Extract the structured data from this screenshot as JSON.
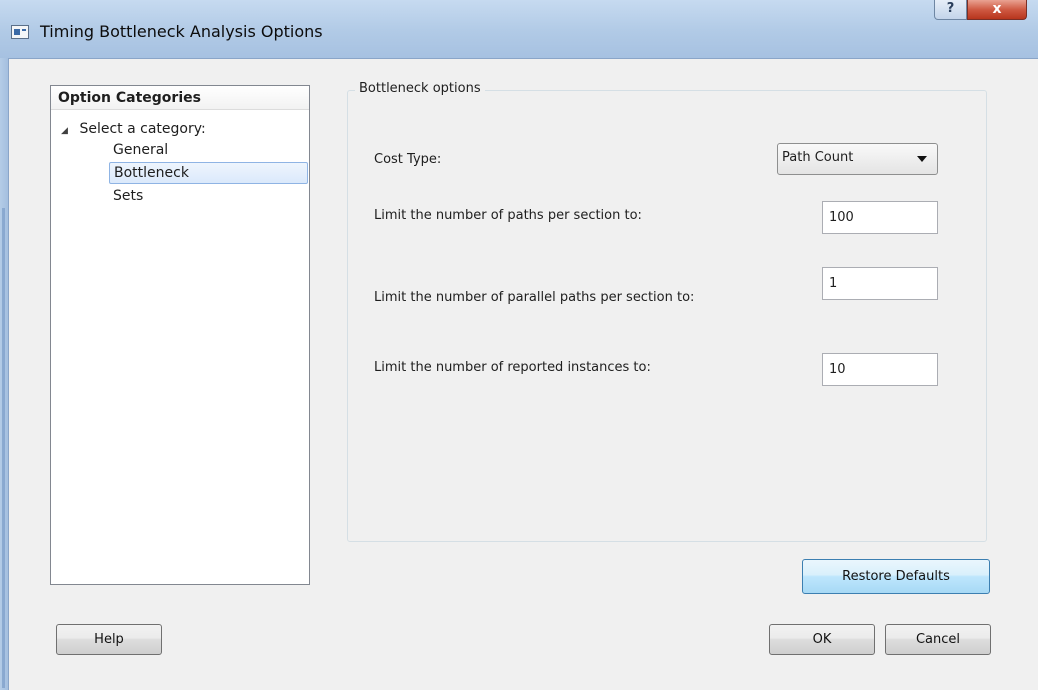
{
  "window": {
    "title": "Timing Bottleneck Analysis Options",
    "help_glyph": "?",
    "close_glyph": "x"
  },
  "categories": {
    "header": "Option Categories",
    "root_label": "Select a category:",
    "items": [
      {
        "label": "General",
        "selected": false
      },
      {
        "label": "Bottleneck",
        "selected": true
      },
      {
        "label": "Sets",
        "selected": false
      }
    ]
  },
  "bottleneck": {
    "group_title": "Bottleneck options",
    "cost_type_label": "Cost Type:",
    "cost_type_value": "Path Count",
    "paths_per_section_label": "Limit the number of paths per section to:",
    "paths_per_section_value": "100",
    "parallel_paths_label": "Limit the number of parallel paths per section to:",
    "parallel_paths_value": "1",
    "reported_instances_label": "Limit the number of reported instances to:",
    "reported_instances_value": "10"
  },
  "buttons": {
    "restore_defaults": "Restore Defaults",
    "help": "Help",
    "ok": "OK",
    "cancel": "Cancel"
  },
  "icons": {
    "app": "window-app-icon",
    "help": "help-icon",
    "close": "close-icon",
    "tree_expand": "tree-expanded-arrow-icon",
    "dropdown": "chevron-down-icon"
  }
}
